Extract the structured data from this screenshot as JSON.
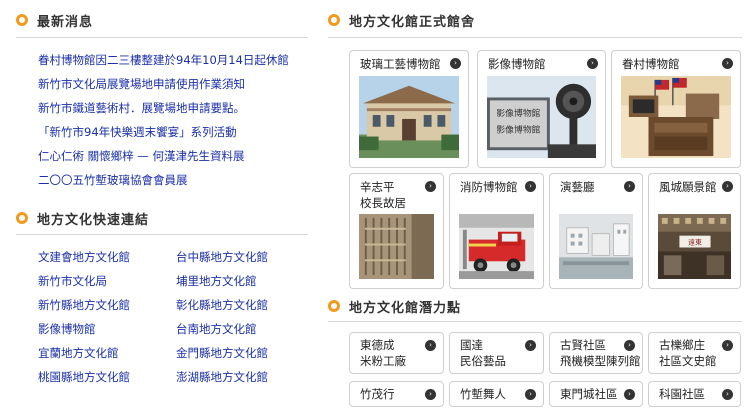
{
  "latest": {
    "title": "最新消息",
    "items": [
      "眷村博物館因二三樓整建於94年10月14日起休館",
      "新竹市文化局展覽場地申請使用作業須知",
      "新竹市鐵道藝術村．展覽場地申請要點。",
      "「新竹市94年快樂週末饗宴」系列活動",
      "仁心仁術 關懷鄉梓 — 何漢津先生資料展",
      "二〇〇五竹塹玻璃協會會員展"
    ]
  },
  "quick_links": {
    "title": "地方文化快速連結",
    "items": [
      "文建會地方文化館",
      "台中縣地方文化館",
      "新竹市文化局",
      "埔里地方文化館",
      "新竹縣地方文化館",
      "彰化縣地方文化館",
      "影像博物館",
      "台南地方文化館",
      "宜蘭地方文化館",
      "金門縣地方文化館",
      "桃園縣地方文化館",
      "澎湖縣地方文化館"
    ]
  },
  "official": {
    "title": "地方文化館正式館舍",
    "row1": [
      "玻璃工藝博物館",
      "影像博物館",
      "眷村博物館"
    ],
    "row2": [
      {
        "l1": "辛志平",
        "l2": "校長故居"
      },
      {
        "l1": "消防博物館",
        "l2": ""
      },
      {
        "l1": "演藝廳",
        "l2": ""
      },
      {
        "l1": "風城願景館",
        "l2": ""
      }
    ],
    "cinema_sign": "影像博物館",
    "shop_sign": "遠東"
  },
  "potential": {
    "title": "地方文化館潛力點",
    "items": [
      {
        "l1": "東德成",
        "l2": "米粉工廠"
      },
      {
        "l1": "國達",
        "l2": "民俗藝品"
      },
      {
        "l1": "古賢社區",
        "l2": "飛機模型陳列館"
      },
      {
        "l1": "古櫟鄉庄",
        "l2": "社區文史館"
      },
      {
        "l1": "竹茂行",
        "l2": ""
      },
      {
        "l1": "竹塹舞人",
        "l2": ""
      },
      {
        "l1": "東門城社區",
        "l2": ""
      },
      {
        "l1": "科園社區",
        "l2": ""
      }
    ]
  },
  "colors": {
    "accent": "#f29a1e",
    "link": "#1a2fa8"
  },
  "icons": {
    "arrow": "›"
  }
}
